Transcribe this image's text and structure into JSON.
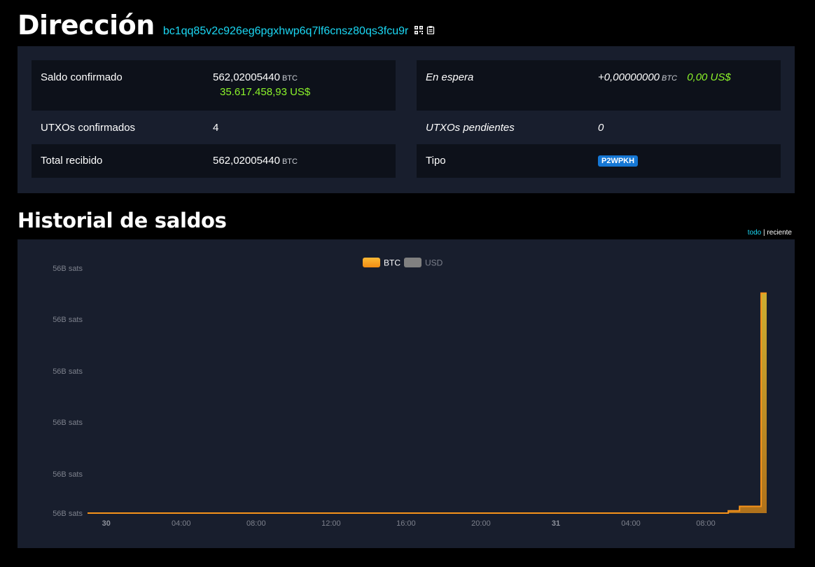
{
  "header": {
    "title": "Dirección",
    "address": "bc1qq85v2c926eg6pgxhwp6q7lf6cnsz80qs3fcu9r",
    "icons": [
      "qr-code-icon",
      "clipboard-icon"
    ]
  },
  "summary": {
    "confirmed_balance": {
      "label": "Saldo confirmado",
      "btc": "562,02005440",
      "unit": "BTC",
      "usd": "35.617.458,93 US$"
    },
    "pending": {
      "label": "En espera",
      "btc": "+0,00000000",
      "unit": "BTC",
      "usd": "0,00 US$"
    },
    "confirmed_utxos": {
      "label": "UTXOs confirmados",
      "value": "4"
    },
    "pending_utxos": {
      "label": "UTXOs pendientes",
      "value": "0"
    },
    "total_received": {
      "label": "Total recibido",
      "btc": "562,02005440",
      "unit": "BTC"
    },
    "type": {
      "label": "Tipo",
      "value": "P2WPKH"
    }
  },
  "history": {
    "title": "Historial de saldos",
    "range": {
      "active": "todo",
      "separator": "|",
      "other": "reciente"
    }
  },
  "colors": {
    "accent": "#1bd8f4",
    "usd_green": "#8bf32a",
    "badge_blue": "#1577d4",
    "btc_series": "#f7931a",
    "usd_series": "#808080",
    "panel_bg": "#181e2d"
  },
  "chart_data": {
    "type": "area",
    "legend": [
      {
        "name": "BTC",
        "color": "#f7931a",
        "active": true
      },
      {
        "name": "USD",
        "color": "#808080",
        "active": false
      }
    ],
    "legend_position": "top-center",
    "y_tick_labels": [
      "56B sats",
      "56B sats",
      "56B sats",
      "56B sats",
      "56B sats",
      "56B sats"
    ],
    "x_tick_labels": [
      {
        "label": "30",
        "bold": true
      },
      {
        "label": "04:00",
        "bold": false
      },
      {
        "label": "08:00",
        "bold": false
      },
      {
        "label": "12:00",
        "bold": false
      },
      {
        "label": "16:00",
        "bold": false
      },
      {
        "label": "20:00",
        "bold": false
      },
      {
        "label": "31",
        "bold": true
      },
      {
        "label": "04:00",
        "bold": false
      },
      {
        "label": "08:00",
        "bold": false
      }
    ],
    "x_hours": [
      0,
      4,
      8,
      12,
      16,
      20,
      24,
      28,
      32
    ],
    "x_range_hours": [
      -1,
      35.25
    ],
    "y_range_relative": [
      0,
      1
    ],
    "series": [
      {
        "name": "BTC",
        "points_hours": [
          [
            -1,
            0.0
          ],
          [
            33.2,
            0.0
          ],
          [
            33.2,
            0.01
          ],
          [
            33.8,
            0.01
          ],
          [
            33.8,
            0.03
          ],
          [
            34.95,
            0.03
          ],
          [
            34.95,
            0.985
          ],
          [
            35.25,
            0.985
          ]
        ]
      }
    ],
    "grid": false
  }
}
